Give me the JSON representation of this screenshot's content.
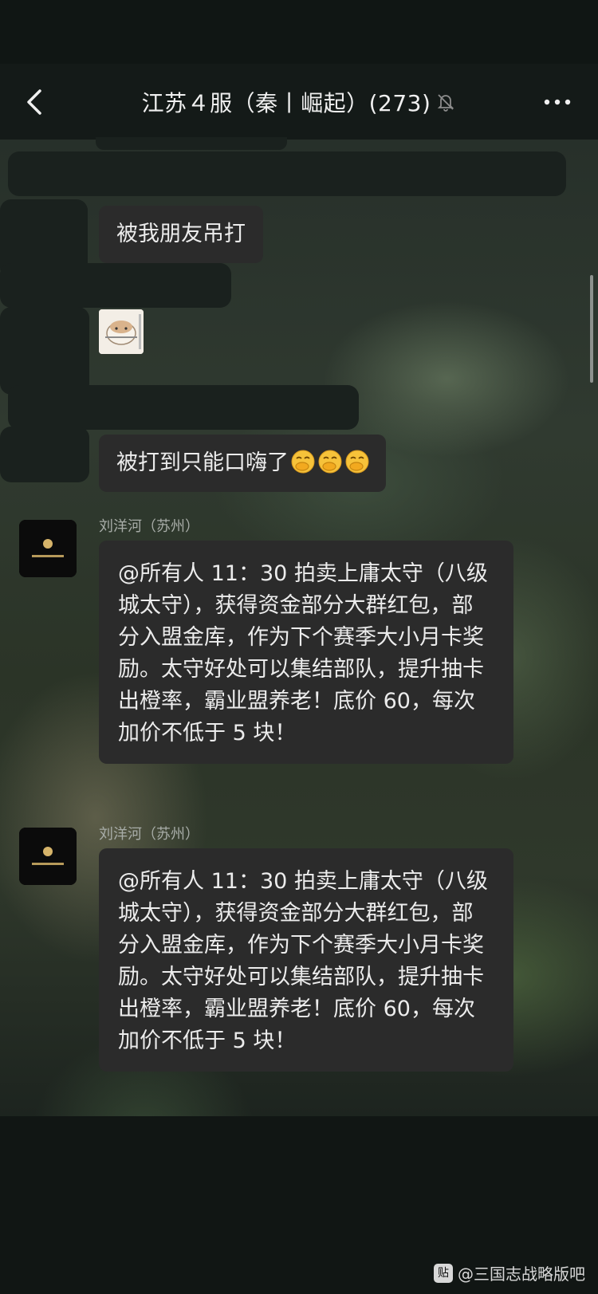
{
  "header": {
    "title": "江苏４服（秦丨崛起）(273)",
    "back_icon": "chevron-left-icon",
    "mute_icon": "bell-slash-icon",
    "more_icon": "more-dots-icon"
  },
  "messages": [
    {
      "type": "text",
      "text": "被我朋友吊打"
    },
    {
      "type": "sticker",
      "icon": "hamster-sticker-icon"
    },
    {
      "type": "text",
      "text": "被打到只能口嗨了",
      "emoji": "hand-over-mouth-emoji-icon",
      "emoji_count": 3
    },
    {
      "type": "text",
      "sender": "刘洋河（苏州）",
      "text": "@所有人 11：30 拍卖上庸太守（八级城太守），获得资金部分大群红包，部分入盟金库，作为下个赛季大小月卡奖励。太守好处可以集结部队，提升抽卡出橙率，霸业盟养老！底价 60，每次加价不低于 5 块！"
    },
    {
      "type": "text",
      "sender": "刘洋河（苏州）",
      "text": "@所有人 11：30 拍卖上庸太守（八级城太守），获得资金部分大群红包，部分入盟金库，作为下个赛季大小月卡奖励。太守好处可以集结部队，提升抽卡出橙率，霸业盟养老！底价 60，每次加价不低于 5 块！"
    }
  ],
  "watermark": {
    "icon": "tieba-icon",
    "icon_text": "贴",
    "text": "@三国志战略版吧"
  },
  "colors": {
    "bubble": "#2b2b2b",
    "header_bg": "#141a18",
    "text": "#ececec"
  }
}
